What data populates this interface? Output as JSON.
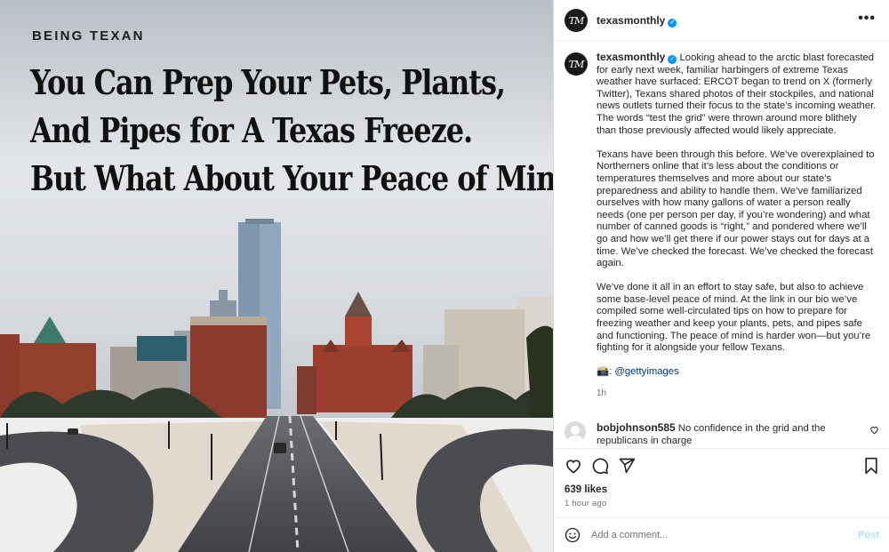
{
  "media": {
    "kicker": "BEING TEXAN",
    "headline_lines": [
      "You Can Prep Your Pets, Plants,",
      "And Pipes for A Texas Freeze.",
      "But What About Your Peace of Mind?"
    ]
  },
  "header": {
    "username": "texasmonthly",
    "avatar_text": "TM",
    "more_icon": "more-horizontal-icon"
  },
  "caption": {
    "username": "texasmonthly",
    "paragraphs": [
      "Looking ahead to the arctic blast forecasted for early next week, familiar harbingers of extreme Texas weather have surfaced: ERCOT began to trend on X (formerly Twitter), Texans shared photos of their stockpiles, and national news outlets turned their focus to the state’s incoming weather. The words “test the grid” were thrown around more blithely than those previously affected would likely appreciate.",
      "Texans have been through this before. We’ve overexplained to Northerners online that it’s less about the conditions or temperatures themselves and more about our state’s preparedness and ability to handle them. We’ve familiarized ourselves with how many gallons of water a person really needs (one per person per day, if you’re wondering) and what number of canned goods is “right,” and pondered where we’ll go and how we’ll get there if our power stays out for days at a time. We’ve checked the forecast. We’ve checked the forecast again.",
      "We’ve done it all in an effort to stay safe, but also to achieve some base-level peace of mind. At the link in our bio we’ve compiled some well-circulated tips on how to prepare for freezing weather and keep your plants, pets, and pipes safe and functioning. The peace of mind is harder won—but you’re fighting for it alongside your fellow Texans."
    ],
    "credit_emoji": "📸",
    "credit_handle": "@gettyimages",
    "age": "1h"
  },
  "comment": {
    "username": "bobjohnson585",
    "text": "No confidence in the grid and the republicans in charge"
  },
  "actions": {
    "likes": "639 likes",
    "posted": "1 hour ago"
  },
  "add_comment": {
    "placeholder": "Add a comment...",
    "post_label": "Post"
  },
  "colors": {
    "accent_blue": "#0095f6",
    "link_blue": "#00376b",
    "post_disabled": "#b2dffc",
    "sky": "#c9ced4",
    "brick": "#8e3b2c"
  }
}
